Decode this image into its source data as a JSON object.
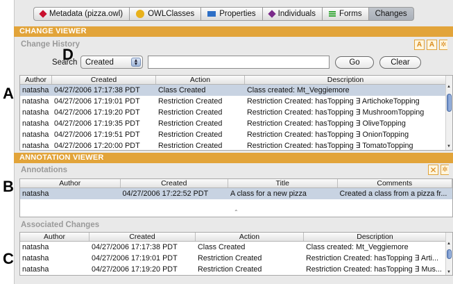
{
  "side_labels": {
    "a": "A",
    "b": "B",
    "c": "C",
    "d": "D"
  },
  "tabs": [
    {
      "label": "Metadata (pizza.owl)",
      "icon": "metadata-diamond-icon",
      "color": "#c8102e"
    },
    {
      "label": "OWLClasses",
      "icon": "owlclasses-dot-icon",
      "color": "#e8b11c"
    },
    {
      "label": "Properties",
      "icon": "properties-rect-icon",
      "color": "#2e6fc6"
    },
    {
      "label": "Individuals",
      "icon": "individuals-diamond-icon",
      "color": "#7a2a8a"
    },
    {
      "label": "Forms",
      "icon": "forms-lines-icon",
      "color": "#38a838"
    },
    {
      "label": "Changes",
      "icon": "",
      "color": ""
    }
  ],
  "active_tab": "Changes",
  "change_viewer": {
    "header": "CHANGE VIEWER",
    "history_title": "Change History",
    "search_label": "Search",
    "search_field": "Created",
    "search_value": "",
    "go_label": "Go",
    "clear_label": "Clear",
    "columns": [
      "Author",
      "Created",
      "Action",
      "Description"
    ],
    "rows": [
      {
        "author": "natasha",
        "created": "04/27/2006 17:17:38 PDT",
        "action": "Class Created",
        "description": "Class created: Mt_Veggiemore"
      },
      {
        "author": "natasha",
        "created": "04/27/2006 17:19:01 PDT",
        "action": "Restriction Created",
        "description": "Restriction Created: hasTopping ∃ ArtichokeTopping"
      },
      {
        "author": "natasha",
        "created": "04/27/2006 17:19:20 PDT",
        "action": "Restriction Created",
        "description": "Restriction Created: hasTopping ∃ MushroomTopping"
      },
      {
        "author": "natasha",
        "created": "04/27/2006 17:19:35 PDT",
        "action": "Restriction Created",
        "description": "Restriction Created: hasTopping ∃ OliveTopping"
      },
      {
        "author": "natasha",
        "created": "04/27/2006 17:19:51 PDT",
        "action": "Restriction Created",
        "description": "Restriction Created: hasTopping ∃ OnionTopping"
      },
      {
        "author": "natasha",
        "created": "04/27/2006 17:20:00 PDT",
        "action": "Restriction Created",
        "description": "Restriction Created: hasTopping ∃ TomatoTopping"
      }
    ]
  },
  "annotation_viewer": {
    "header": "ANNOTATION VIEWER",
    "annotations_title": "Annotations",
    "columns": [
      "Author",
      "Created",
      "Title",
      "Comments"
    ],
    "rows": [
      {
        "author": "natasha",
        "created": "04/27/2006 17:22:52 PDT",
        "title": "A class for a new pizza",
        "comments": "Created a class from a pizza fr..."
      }
    ],
    "associated_title": "Associated Changes",
    "assoc_columns": [
      "Author",
      "Created",
      "Action",
      "Description"
    ],
    "assoc_rows": [
      {
        "author": "natasha",
        "created": "04/27/2006 17:17:38 PDT",
        "action": "Class Created",
        "description": "Class created: Mt_Veggiemore"
      },
      {
        "author": "natasha",
        "created": "04/27/2006 17:19:01 PDT",
        "action": "Restriction Created",
        "description": "Restriction Created: hasTopping ∃ Arti..."
      },
      {
        "author": "natasha",
        "created": "04/27/2006 17:19:20 PDT",
        "action": "Restriction Created",
        "description": "Restriction Created: hasTopping ∃ Mus..."
      }
    ]
  },
  "colors": {
    "accent_orange": "#e2a43a",
    "selection_blue": "#c8d3e2"
  }
}
